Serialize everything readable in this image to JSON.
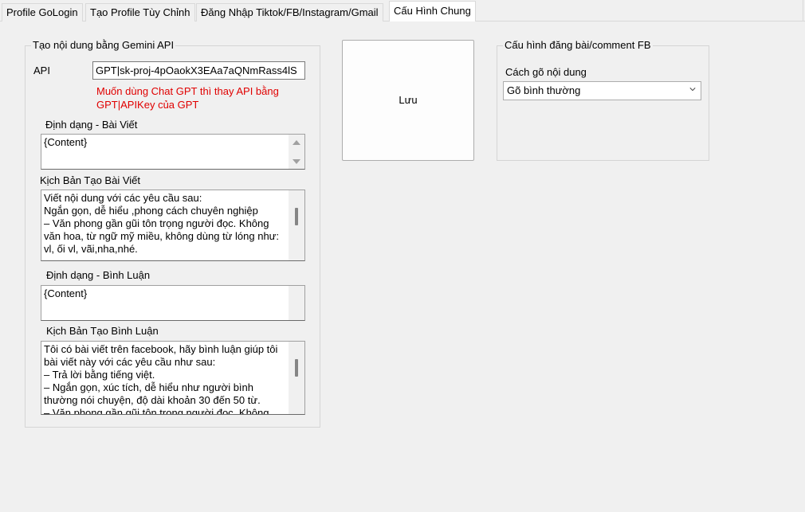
{
  "tabs": [
    {
      "label": "Profile GoLogin"
    },
    {
      "label": "Tạo Profile Tùy Chỉnh"
    },
    {
      "label": "Đăng Nhập Tiktok/FB/Instagram/Gmail"
    },
    {
      "label": "Cấu Hình Chung"
    }
  ],
  "gemini": {
    "title": "Tạo nội dung bằng Gemini API",
    "api_label": "API",
    "api_value": "GPT|sk-proj-4pOaokX3EAa7aQNmRass4lS",
    "hint": "Muốn dùng Chat GPT thì thay API bằng GPT|APIKey của GPT",
    "post_format_label": "Định dạng - Bài Viết",
    "post_format_value": "{Content}",
    "post_script_label": "Kịch Bản Tạo Bài Viết",
    "post_script_value": "Viết nội dung với các yêu cầu sau:\nNgắn gọn, dễ hiểu ,phong cách chuyên nghiệp\n– Văn phong gần gũi tôn trọng người đọc. Không văn hoa, từ ngữ mỹ miều, không dùng từ lóng như: vl, ối vl, vãi,nha,nhé.",
    "comment_format_label": "Định dạng - Bình Luận",
    "comment_format_value": "{Content}",
    "comment_script_label": "Kịch Bản Tạo Bình Luận",
    "comment_script_value": "Tôi có bài viết trên facebook, hãy bình luận giúp tôi bài viết này với các yêu cầu như sau:\n– Trả lời bằng tiếng việt.\n– Ngắn gọn, xúc tích, dễ hiểu như người bình thường nói chuyện, độ dài khoản 30 đến 50 từ.\n– Văn phong gần gũi tôn trọng người đọc. Không văn"
  },
  "save_label": "Lưu",
  "fb": {
    "title": "Cấu hình đăng bài/comment FB",
    "typing_label": "Cách gõ nội dung",
    "typing_value": "Gõ bình thường"
  }
}
